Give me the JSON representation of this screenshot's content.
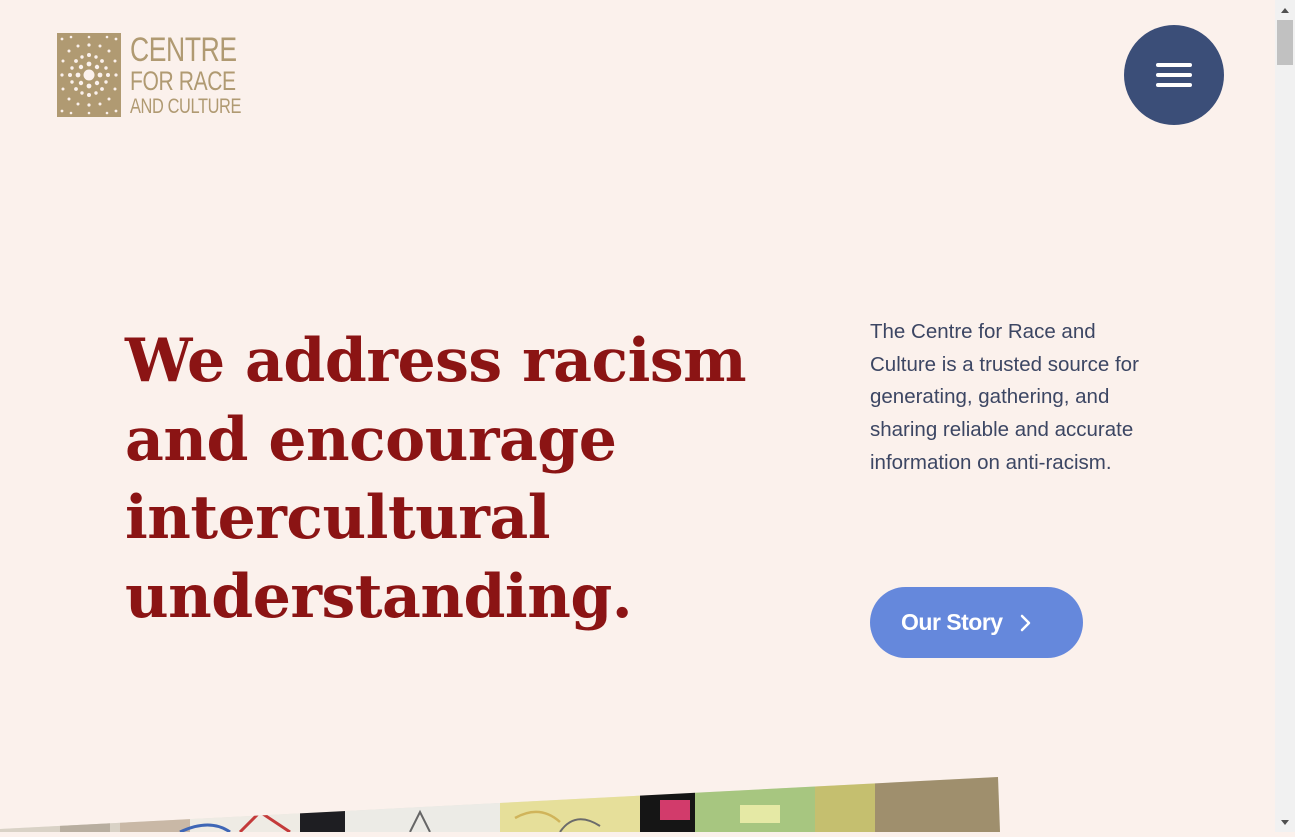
{
  "logo": {
    "line1": "CENTRE",
    "line2": "FOR RACE",
    "line3": "AND CULTURE",
    "color": "#b09a72"
  },
  "menu": {
    "icon": "hamburger-icon",
    "color": "#3b4e78"
  },
  "hero": {
    "headline": "We address racism and encourage intercultural understanding.",
    "description": "The Centre for Race and Culture is a trusted source for generating, gathering, and sharing reliable and accurate information on anti-racism.",
    "cta_label": "Our Story",
    "cta_icon": "chevron-right-icon",
    "headline_color": "#8b1414",
    "cta_color": "#6588dc"
  },
  "scrollbar": {
    "up_icon": "scroll-up-arrow-icon",
    "down_icon": "scroll-down-arrow-icon"
  }
}
